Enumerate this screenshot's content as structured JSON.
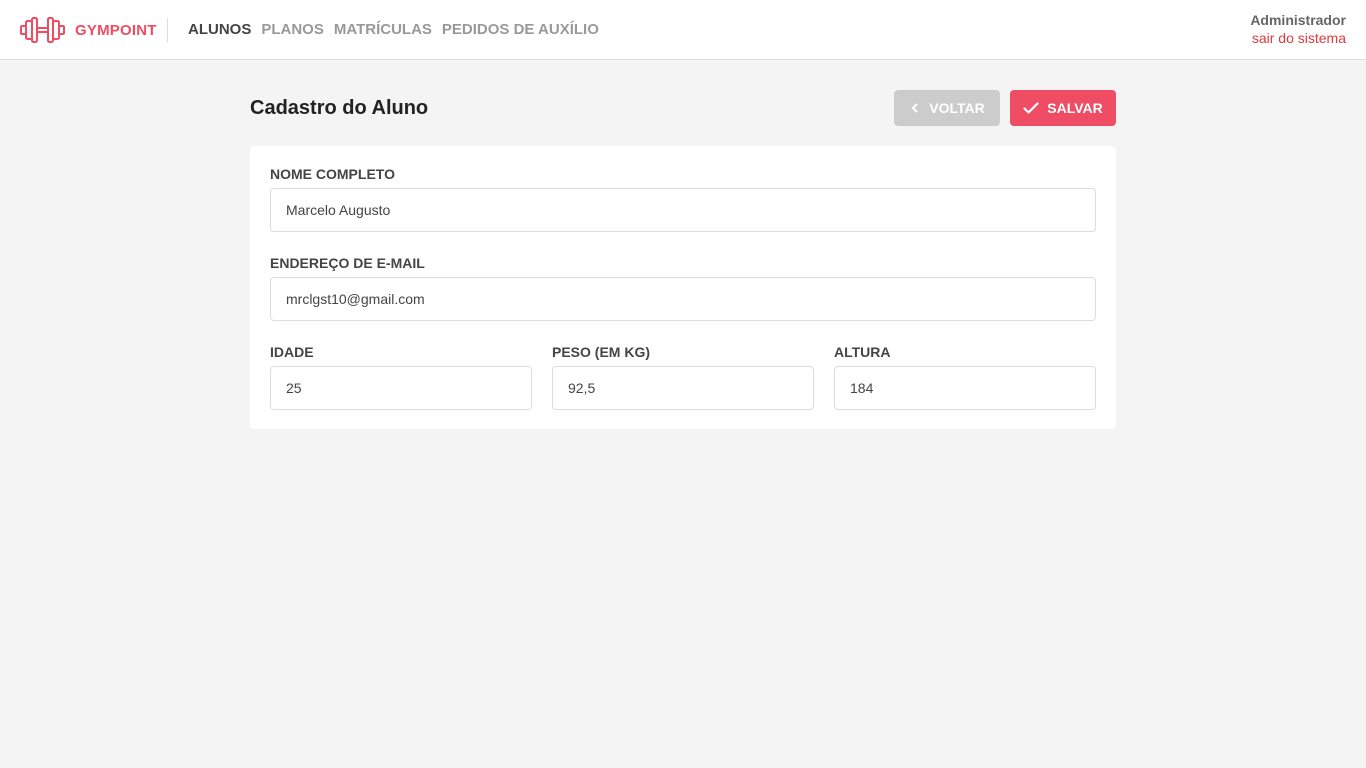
{
  "header": {
    "logo_text": "GYMPOINT",
    "nav": [
      {
        "label": "ALUNOS",
        "active": true
      },
      {
        "label": "PLANOS",
        "active": false
      },
      {
        "label": "MATRÍCULAS",
        "active": false
      },
      {
        "label": "PEDIDOS DE AUXÍLIO",
        "active": false
      }
    ],
    "user_name": "Administrador",
    "logout_label": "sair do sistema"
  },
  "page": {
    "title": "Cadastro do Aluno",
    "back_label": "VOLTAR",
    "save_label": "SALVAR"
  },
  "form": {
    "name": {
      "label": "NOME COMPLETO",
      "value": "Marcelo Augusto"
    },
    "email": {
      "label": "ENDEREÇO DE E-MAIL",
      "value": "mrclgst10@gmail.com"
    },
    "age": {
      "label": "IDADE",
      "value": "25"
    },
    "weight": {
      "label": "PESO (EM KG)",
      "value": "92,5"
    },
    "height": {
      "label": "ALTURA",
      "value": "184"
    }
  },
  "colors": {
    "brand": "#ee4d64",
    "background": "#f4f4f4",
    "back_button": "#cccccc",
    "logout": "#de3b3b"
  },
  "icons": {
    "logo": "dumbbell-icon",
    "back": "chevron-left-icon",
    "save": "check-icon"
  }
}
